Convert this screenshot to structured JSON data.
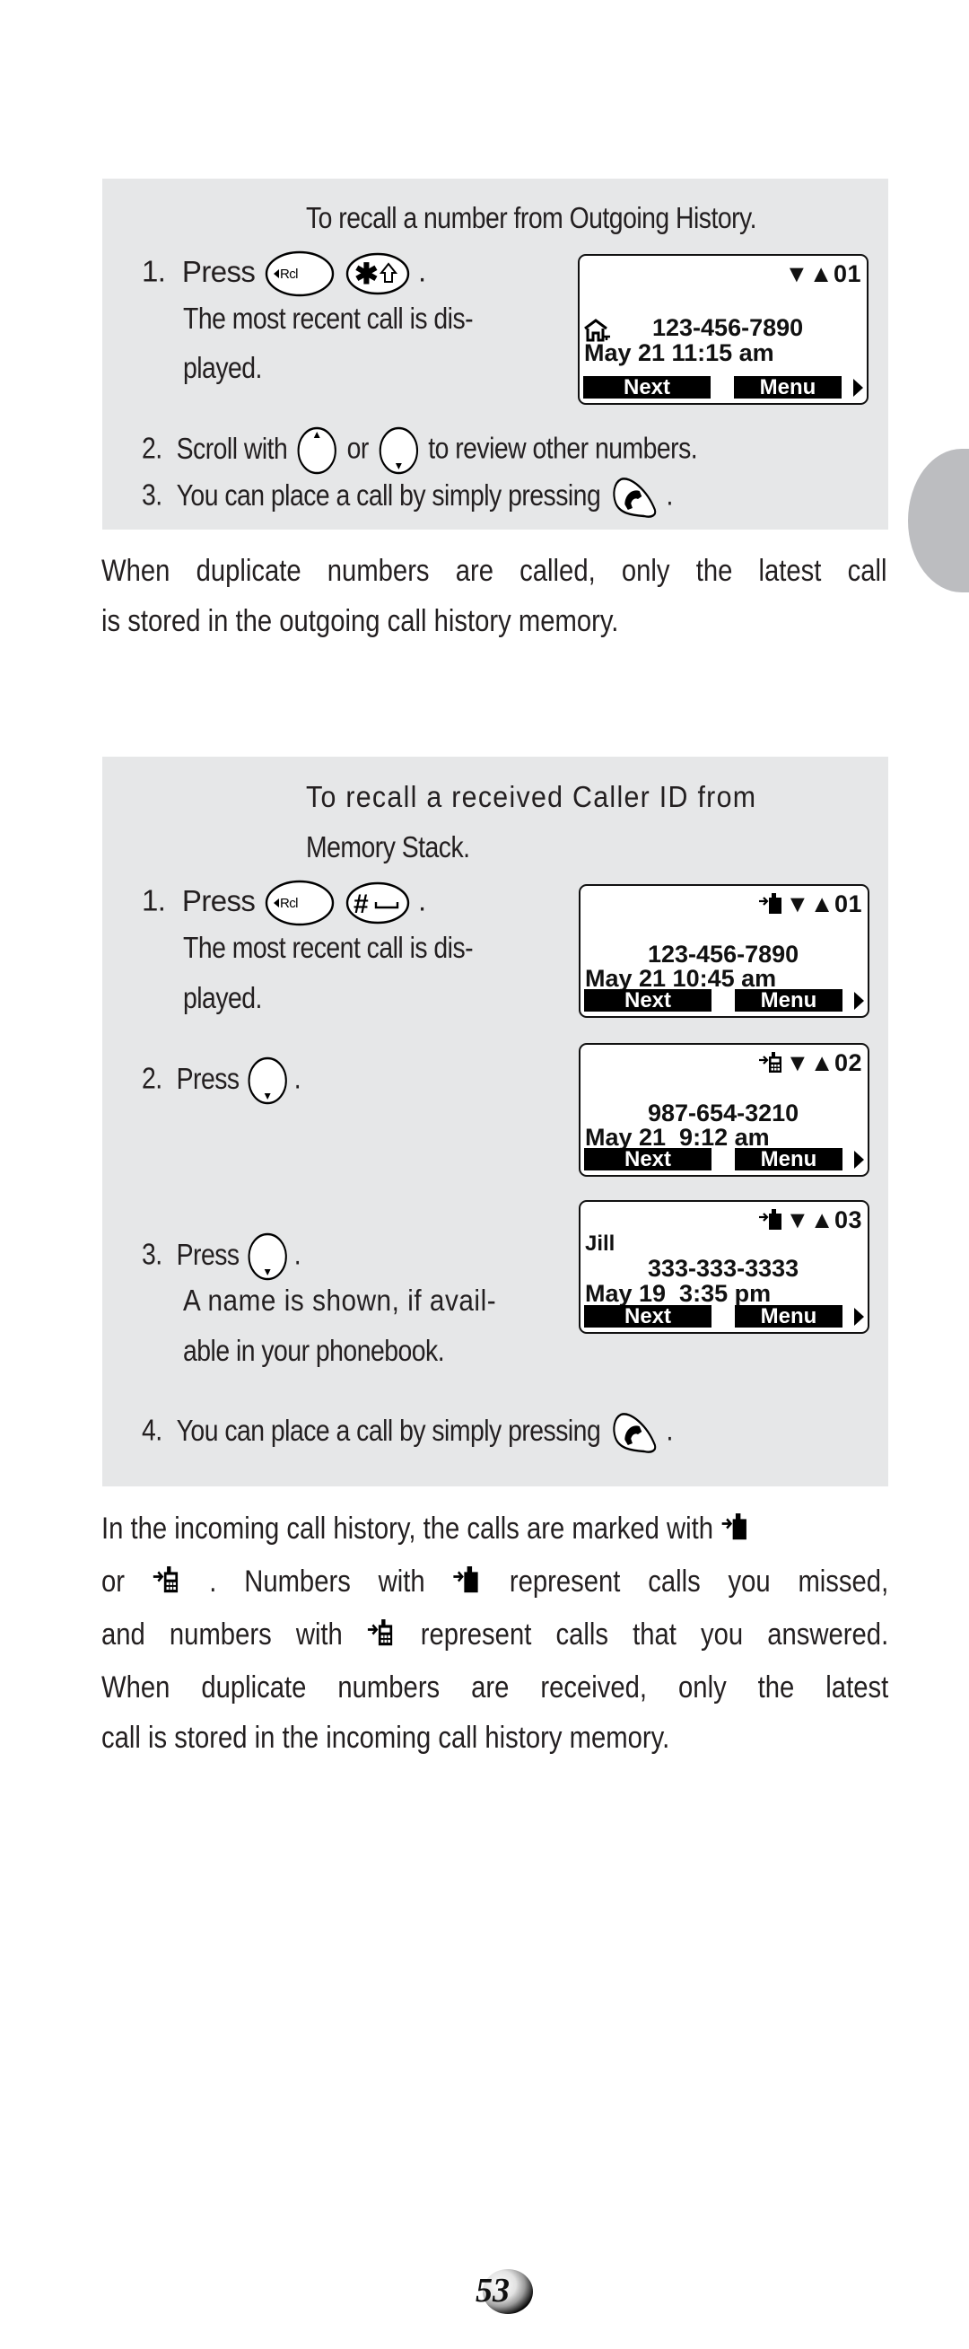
{
  "section_outgoing": {
    "heading": "To recall a number from Outgoing History.",
    "step1": {
      "num": "1.",
      "text": "Press",
      "keys": [
        "Rcl",
        "*⇧"
      ],
      "end": ".",
      "note_lines": [
        "The most recent call is dis-",
        "played."
      ]
    },
    "step2": {
      "num": "2.",
      "before": "Scroll with",
      "middle": "or",
      "after": "to review other numbers."
    },
    "step3": {
      "num": "3.",
      "text": "You can place a call by simply pressing",
      "end": "."
    },
    "lcd": {
      "icon": "home-phone-icon",
      "index": "▼▲01",
      "number": "123-456-7890",
      "datetime": "May 21 11:15 am",
      "soft_left": "Next",
      "soft_right": "Menu"
    },
    "note_lines": [
      "When duplicate numbers are called, only the latest call",
      "is stored in the outgoing call history memory."
    ]
  },
  "section_incoming": {
    "heading_lines": [
      "To recall a received Caller ID from",
      "Memory Stack."
    ],
    "step1": {
      "num": "1.",
      "text": "Press",
      "keys": [
        "Rcl",
        "#␣"
      ],
      "end": ".",
      "note_lines": [
        "The most recent call is dis-",
        "played."
      ]
    },
    "step2": {
      "num": "2.",
      "text": "Press",
      "end": "."
    },
    "step3": {
      "num": "3.",
      "text": "Press",
      "end": ".",
      "note_lines": [
        "A name is shown, if avail-",
        "able in your phonebook."
      ]
    },
    "step4": {
      "num": "4.",
      "text": "You can place a call by simply pressing",
      "end": "."
    },
    "lcds": [
      {
        "status": "missed",
        "index": "▼▲01",
        "name": "",
        "number": "123-456-7890",
        "datetime": "May 21 10:45 am",
        "soft_left": "Next",
        "soft_right": "Menu"
      },
      {
        "status": "answered",
        "index": "▼▲02",
        "name": "",
        "number": "987-654-3210",
        "datetime": "May 21  9:12 am",
        "soft_left": "Next",
        "soft_right": "Menu"
      },
      {
        "status": "missed",
        "index": "▼▲03",
        "name": "Jill",
        "number": "333-333-3333",
        "datetime": "May 19  3:35 pm",
        "soft_left": "Next",
        "soft_right": "Menu"
      }
    ],
    "note": {
      "l1": "In the incoming call history, the calls are marked with",
      "l2a": "or",
      "l2b": ". Numbers with",
      "l2c": "represent calls you missed,",
      "l3a": "and numbers with",
      "l3b": "represent calls that you answered.",
      "l4": "When duplicate numbers are received, only the latest",
      "l5": "call is stored in the incoming call history memory."
    }
  },
  "page_number": "53"
}
